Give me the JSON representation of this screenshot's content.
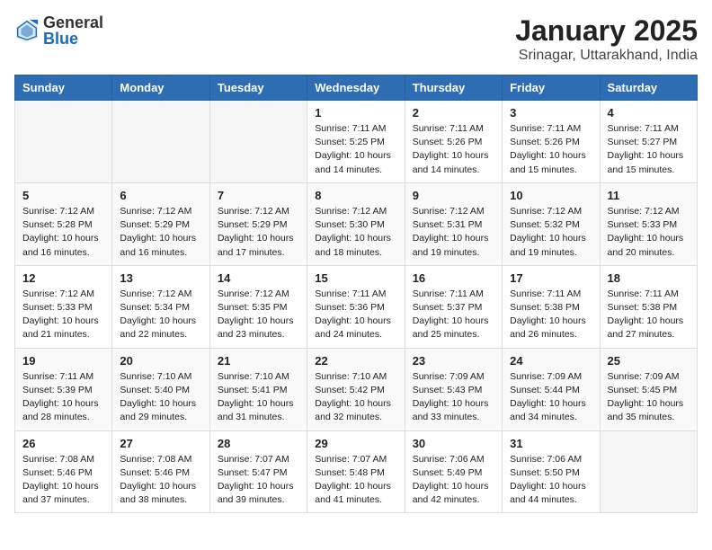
{
  "header": {
    "logo_general": "General",
    "logo_blue": "Blue",
    "month_title": "January 2025",
    "location": "Srinagar, Uttarakhand, India"
  },
  "weekdays": [
    "Sunday",
    "Monday",
    "Tuesday",
    "Wednesday",
    "Thursday",
    "Friday",
    "Saturday"
  ],
  "weeks": [
    [
      {
        "day": "",
        "info": ""
      },
      {
        "day": "",
        "info": ""
      },
      {
        "day": "",
        "info": ""
      },
      {
        "day": "1",
        "info": "Sunrise: 7:11 AM\nSunset: 5:25 PM\nDaylight: 10 hours and 14 minutes."
      },
      {
        "day": "2",
        "info": "Sunrise: 7:11 AM\nSunset: 5:26 PM\nDaylight: 10 hours and 14 minutes."
      },
      {
        "day": "3",
        "info": "Sunrise: 7:11 AM\nSunset: 5:26 PM\nDaylight: 10 hours and 15 minutes."
      },
      {
        "day": "4",
        "info": "Sunrise: 7:11 AM\nSunset: 5:27 PM\nDaylight: 10 hours and 15 minutes."
      }
    ],
    [
      {
        "day": "5",
        "info": "Sunrise: 7:12 AM\nSunset: 5:28 PM\nDaylight: 10 hours and 16 minutes."
      },
      {
        "day": "6",
        "info": "Sunrise: 7:12 AM\nSunset: 5:29 PM\nDaylight: 10 hours and 16 minutes."
      },
      {
        "day": "7",
        "info": "Sunrise: 7:12 AM\nSunset: 5:29 PM\nDaylight: 10 hours and 17 minutes."
      },
      {
        "day": "8",
        "info": "Sunrise: 7:12 AM\nSunset: 5:30 PM\nDaylight: 10 hours and 18 minutes."
      },
      {
        "day": "9",
        "info": "Sunrise: 7:12 AM\nSunset: 5:31 PM\nDaylight: 10 hours and 19 minutes."
      },
      {
        "day": "10",
        "info": "Sunrise: 7:12 AM\nSunset: 5:32 PM\nDaylight: 10 hours and 19 minutes."
      },
      {
        "day": "11",
        "info": "Sunrise: 7:12 AM\nSunset: 5:33 PM\nDaylight: 10 hours and 20 minutes."
      }
    ],
    [
      {
        "day": "12",
        "info": "Sunrise: 7:12 AM\nSunset: 5:33 PM\nDaylight: 10 hours and 21 minutes."
      },
      {
        "day": "13",
        "info": "Sunrise: 7:12 AM\nSunset: 5:34 PM\nDaylight: 10 hours and 22 minutes."
      },
      {
        "day": "14",
        "info": "Sunrise: 7:12 AM\nSunset: 5:35 PM\nDaylight: 10 hours and 23 minutes."
      },
      {
        "day": "15",
        "info": "Sunrise: 7:11 AM\nSunset: 5:36 PM\nDaylight: 10 hours and 24 minutes."
      },
      {
        "day": "16",
        "info": "Sunrise: 7:11 AM\nSunset: 5:37 PM\nDaylight: 10 hours and 25 minutes."
      },
      {
        "day": "17",
        "info": "Sunrise: 7:11 AM\nSunset: 5:38 PM\nDaylight: 10 hours and 26 minutes."
      },
      {
        "day": "18",
        "info": "Sunrise: 7:11 AM\nSunset: 5:38 PM\nDaylight: 10 hours and 27 minutes."
      }
    ],
    [
      {
        "day": "19",
        "info": "Sunrise: 7:11 AM\nSunset: 5:39 PM\nDaylight: 10 hours and 28 minutes."
      },
      {
        "day": "20",
        "info": "Sunrise: 7:10 AM\nSunset: 5:40 PM\nDaylight: 10 hours and 29 minutes."
      },
      {
        "day": "21",
        "info": "Sunrise: 7:10 AM\nSunset: 5:41 PM\nDaylight: 10 hours and 31 minutes."
      },
      {
        "day": "22",
        "info": "Sunrise: 7:10 AM\nSunset: 5:42 PM\nDaylight: 10 hours and 32 minutes."
      },
      {
        "day": "23",
        "info": "Sunrise: 7:09 AM\nSunset: 5:43 PM\nDaylight: 10 hours and 33 minutes."
      },
      {
        "day": "24",
        "info": "Sunrise: 7:09 AM\nSunset: 5:44 PM\nDaylight: 10 hours and 34 minutes."
      },
      {
        "day": "25",
        "info": "Sunrise: 7:09 AM\nSunset: 5:45 PM\nDaylight: 10 hours and 35 minutes."
      }
    ],
    [
      {
        "day": "26",
        "info": "Sunrise: 7:08 AM\nSunset: 5:46 PM\nDaylight: 10 hours and 37 minutes."
      },
      {
        "day": "27",
        "info": "Sunrise: 7:08 AM\nSunset: 5:46 PM\nDaylight: 10 hours and 38 minutes."
      },
      {
        "day": "28",
        "info": "Sunrise: 7:07 AM\nSunset: 5:47 PM\nDaylight: 10 hours and 39 minutes."
      },
      {
        "day": "29",
        "info": "Sunrise: 7:07 AM\nSunset: 5:48 PM\nDaylight: 10 hours and 41 minutes."
      },
      {
        "day": "30",
        "info": "Sunrise: 7:06 AM\nSunset: 5:49 PM\nDaylight: 10 hours and 42 minutes."
      },
      {
        "day": "31",
        "info": "Sunrise: 7:06 AM\nSunset: 5:50 PM\nDaylight: 10 hours and 44 minutes."
      },
      {
        "day": "",
        "info": ""
      }
    ]
  ]
}
